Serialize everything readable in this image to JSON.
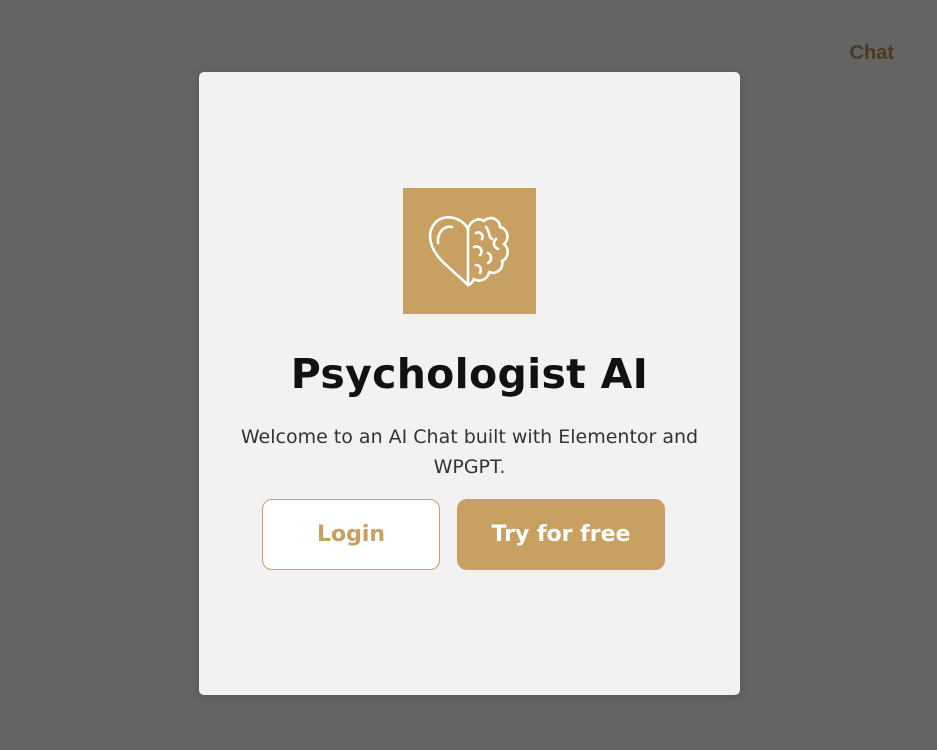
{
  "header": {
    "chat_link": "Chat"
  },
  "modal": {
    "logo_icon": "heart-brain-icon",
    "title": "Psychologist AI",
    "subtitle": "Welcome to an AI Chat built with Elementor and WPGPT.",
    "login_label": "Login",
    "try_label": "Try for free"
  },
  "colors": {
    "backdrop": "#646464",
    "accent": "#c8a062",
    "modal_bg": "#f2f2f2",
    "chat_link": "#4a3a22"
  }
}
